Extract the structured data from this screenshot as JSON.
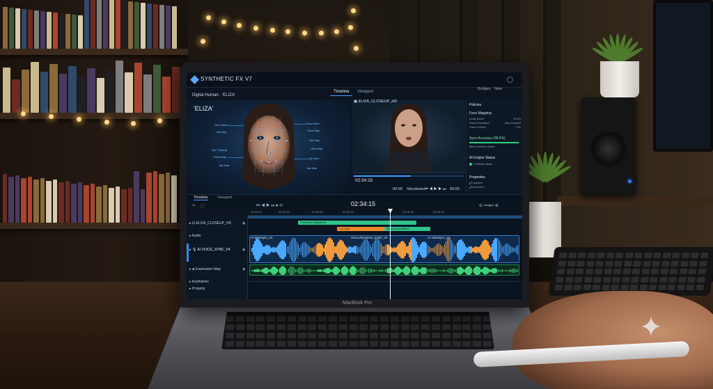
{
  "app": {
    "title": "SYNTHETIC FX V7",
    "top_tabs": [
      "Timeline",
      "Viewport"
    ],
    "top_right": [
      "Bridges",
      "New"
    ]
  },
  "viewer": {
    "left_label": "Digital Human · 'ELIZA'",
    "name": "'ELIZA'",
    "face_annotations_left": [
      "Face Mesh",
      "Lips Map",
      "Eye Tracking",
      "Cheek Map",
      "Jaw Map"
    ],
    "face_annotations_right": [
      "Face Mesh",
      "Brow Map",
      "Eye Map",
      "Nose Map",
      "Lip Sync",
      "Jaw Map"
    ],
    "preview_title": "ELIZA_CLOSEUP_HD",
    "player_time": "02:34:15",
    "player_controls": [
      "00:00",
      "Storyboard",
      "00:00"
    ]
  },
  "side_panel": {
    "header": "Policies",
    "section1": "Face Mapping",
    "rows": [
      {
        "label": "Audio Name",
        "value": "ELIZA"
      },
      {
        "label": "Facial Resolution",
        "value": "Ultra-Detailed"
      },
      {
        "label": "Track Overlay",
        "value": "0.81"
      }
    ],
    "sync_label": "Sync Accuracy (98.6%)",
    "sync_value": 0.986,
    "sync_sub": "Blink Detection Active",
    "engine_label": "AI Engine Status",
    "engine_status": "ProMaker Beam",
    "properties_label": "Properties",
    "properties_items": [
      "Properties",
      "Parameters"
    ]
  },
  "timeline": {
    "tabs": [
      "Timeline",
      "Viewport"
    ],
    "timecode": "02:34:15",
    "ruler": [
      "02:34:15",
      "02:20:15",
      "02:30:00",
      "02:34:15",
      "02:15:18",
      "02:40:15"
    ],
    "tracks": [
      {
        "name": "ELIZA_CLOSEUP_HD"
      },
      {
        "name": "Audio"
      },
      {
        "name": "AI VOICE_SYNC_V4"
      },
      {
        "name": "Expression Map"
      },
      {
        "name": "Keyframes"
      },
      {
        "name": "Property"
      }
    ],
    "clips": {
      "phoneme": "Phoneme Alignment",
      "lip_sync": "Lip Sync",
      "expression": "Expression Blend",
      "wave_titles": [
        "AI Voicesync_V4",
        "Voice phonemes_SYNC_V4",
        "AI VoiceSync_V4"
      ]
    }
  },
  "laptop": {
    "brand": "MacBook Pro"
  },
  "colors": {
    "accent": "#3f9bff",
    "wave_blue": "#4aa8ff",
    "wave_orange": "#f09a3e",
    "wave_green": "#3fd07a",
    "clip_green": "#2fc28a",
    "clip_orange": "#f08a2c"
  }
}
